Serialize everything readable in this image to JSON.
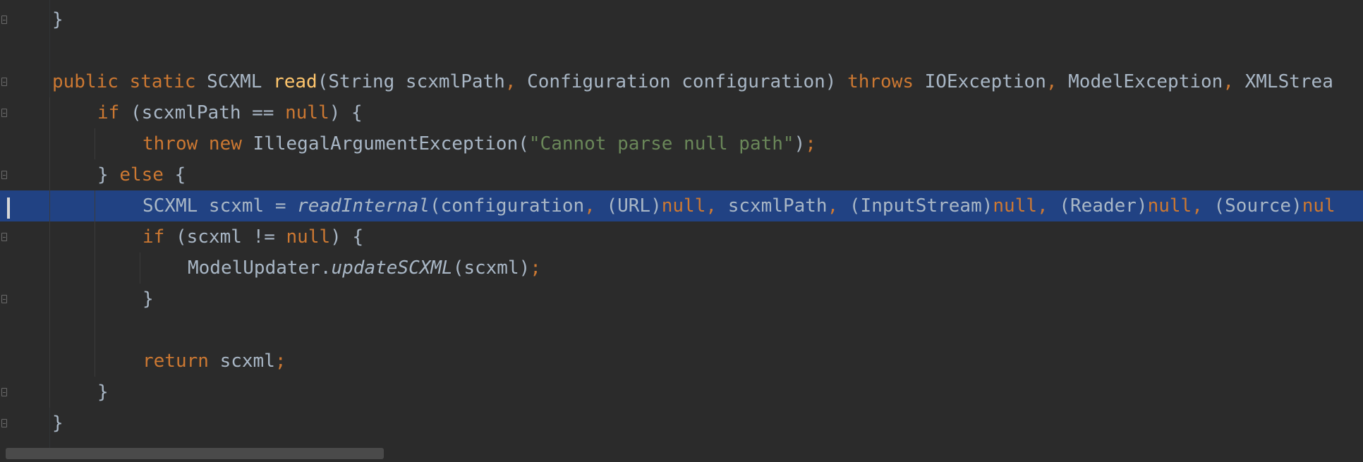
{
  "editor": {
    "lines": [
      [
        {
          "t": "}",
          "c": ""
        }
      ],
      [],
      [
        {
          "t": "public static ",
          "c": "kw"
        },
        {
          "t": "SCXML ",
          "c": ""
        },
        {
          "t": "read",
          "c": "fn"
        },
        {
          "t": "(String scxmlPath",
          "c": ""
        },
        {
          "t": ", ",
          "c": "punct"
        },
        {
          "t": "Configuration configuration) ",
          "c": ""
        },
        {
          "t": "throws ",
          "c": "kw"
        },
        {
          "t": "IOException",
          "c": ""
        },
        {
          "t": ", ",
          "c": "punct"
        },
        {
          "t": "ModelException",
          "c": ""
        },
        {
          "t": ", ",
          "c": "punct"
        },
        {
          "t": "XMLStrea",
          "c": ""
        }
      ],
      [
        {
          "t": "if ",
          "c": "kw"
        },
        {
          "t": "(scxmlPath == ",
          "c": ""
        },
        {
          "t": "null",
          "c": "kw"
        },
        {
          "t": ") {",
          "c": ""
        }
      ],
      [
        {
          "t": "throw new ",
          "c": "kw"
        },
        {
          "t": "IllegalArgumentException(",
          "c": ""
        },
        {
          "t": "\"Cannot parse null path\"",
          "c": "str"
        },
        {
          "t": ")",
          "c": ""
        },
        {
          "t": ";",
          "c": "punct"
        }
      ],
      [
        {
          "t": "} ",
          "c": ""
        },
        {
          "t": "else ",
          "c": "kw"
        },
        {
          "t": "{",
          "c": ""
        }
      ],
      [
        {
          "t": "SCXML scxml = ",
          "c": ""
        },
        {
          "t": "readInternal",
          "c": "ital"
        },
        {
          "t": "(configuration",
          "c": ""
        },
        {
          "t": ", ",
          "c": "punct"
        },
        {
          "t": "(URL)",
          "c": ""
        },
        {
          "t": "null",
          "c": "kw"
        },
        {
          "t": ", ",
          "c": "punct"
        },
        {
          "t": "scxmlPath",
          "c": ""
        },
        {
          "t": ", ",
          "c": "punct"
        },
        {
          "t": "(InputStream)",
          "c": ""
        },
        {
          "t": "null",
          "c": "kw"
        },
        {
          "t": ", ",
          "c": "punct"
        },
        {
          "t": "(Reader)",
          "c": ""
        },
        {
          "t": "null",
          "c": "kw"
        },
        {
          "t": ", ",
          "c": "punct"
        },
        {
          "t": "(Source)",
          "c": ""
        },
        {
          "t": "nul",
          "c": "kw"
        }
      ],
      [
        {
          "t": "if ",
          "c": "kw"
        },
        {
          "t": "(scxml != ",
          "c": ""
        },
        {
          "t": "null",
          "c": "kw"
        },
        {
          "t": ") {",
          "c": ""
        }
      ],
      [
        {
          "t": "ModelUpdater.",
          "c": ""
        },
        {
          "t": "updateSCXML",
          "c": "ital"
        },
        {
          "t": "(scxml)",
          "c": ""
        },
        {
          "t": ";",
          "c": "punct"
        }
      ],
      [
        {
          "t": "}",
          "c": ""
        }
      ],
      [],
      [
        {
          "t": "return ",
          "c": "kw"
        },
        {
          "t": "scxml",
          "c": ""
        },
        {
          "t": ";",
          "c": "punct"
        }
      ],
      [
        {
          "t": "}",
          "c": ""
        }
      ],
      [
        {
          "t": "}",
          "c": ""
        }
      ]
    ]
  }
}
